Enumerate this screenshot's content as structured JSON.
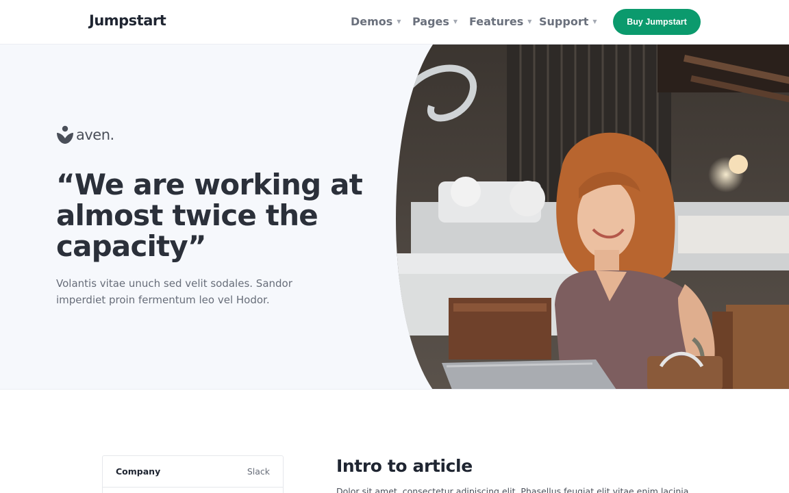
{
  "navbar": {
    "brand": "Jumpstart",
    "items": [
      {
        "label": "Demos"
      },
      {
        "label": "Pages"
      },
      {
        "label": "Features"
      },
      {
        "label": "Support"
      }
    ],
    "cta_label": "Buy Jumpstart",
    "cta_color": "#0b9a6d"
  },
  "hero": {
    "logo_icon": "aven-logo-icon",
    "logo_text": "aven.",
    "quote": "“We are working at almost twice the capacity”",
    "lead": "Volantis vitae unuch sed velit sodales. Sandor imperdiet proin fermentum leo vel Hodor.",
    "photo": "woman-laptop-cafe-photo"
  },
  "company_card": {
    "rows": [
      {
        "key": "Company",
        "value": "Slack"
      }
    ]
  },
  "article": {
    "title": "Intro to article",
    "text": "Dolor sit amet, consectetur adipiscing elit. Phasellus feugiat elit vitae enim lacinia"
  }
}
